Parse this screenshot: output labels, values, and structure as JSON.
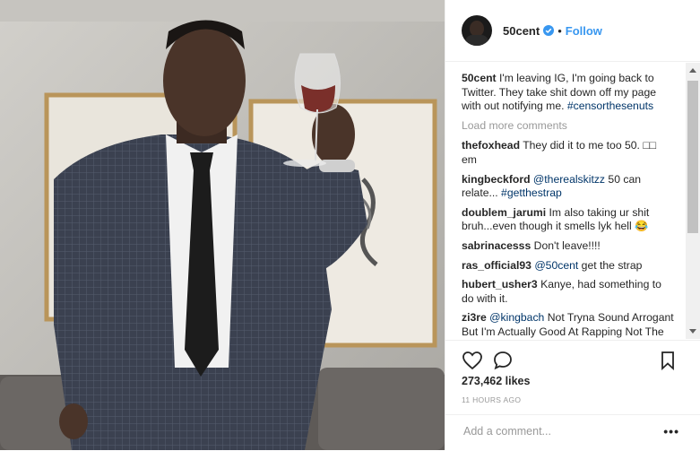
{
  "post": {
    "username": "50cent",
    "follow_label": "Follow",
    "separator": "•",
    "caption": {
      "username": "50cent",
      "text": "I'm leaving IG, I'm going back to Twitter. They take shit down off my page with out notifying me.",
      "hashtag": "#censorthesenuts"
    },
    "load_more_label": "Load more comments",
    "comments": [
      {
        "username": "thefoxhead",
        "text": "They did it to me too 50. □□ em"
      },
      {
        "username": "kingbeckford",
        "mention": "@therealskitzz",
        "text": "50 can relate...",
        "hashtag": "#getthestrap"
      },
      {
        "username": "doublem_jarumi",
        "text": "Im also taking ur shit bruh...even though it smells lyk hell 😂"
      },
      {
        "username": "sabrinacesss",
        "text": "Don't leave!!!!"
      },
      {
        "username": "ras_official93",
        "mention": "@50cent",
        "text": "get the strap"
      },
      {
        "username": "hubert_usher3",
        "text": "Kanye, had something to do with it."
      },
      {
        "username": "zi3re",
        "mention": "@kingbach",
        "text": "Not Tryna Sound Arrogant But I'm Actually Good At Rapping Not The Best But Too Good To Be Another Failure So If Anyone Has The"
      }
    ],
    "likes": "273,462 likes",
    "time": "11 HOURS AGO",
    "add_comment_placeholder": "Add a comment...",
    "more_label": "•••"
  },
  "icons": {
    "like": "heart-icon",
    "comment": "comment-bubble-icon",
    "save": "bookmark-icon",
    "verified": "verified-badge-icon"
  },
  "colors": {
    "link_blue": "#3897f0",
    "hashtag": "#003569",
    "muted": "#999999"
  }
}
